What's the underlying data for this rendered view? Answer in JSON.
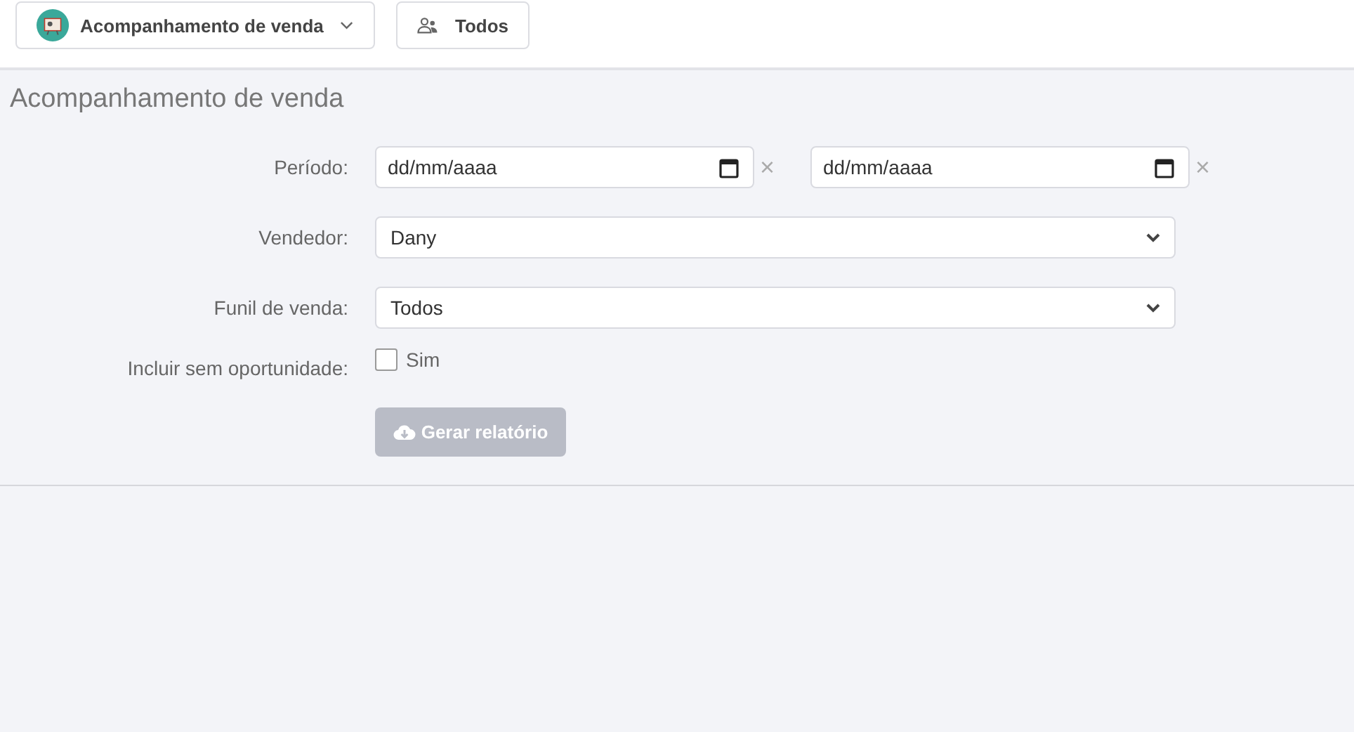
{
  "toolbar": {
    "report_menu": {
      "label": "Acompanhamento de venda"
    },
    "team_button": {
      "label": "Todos"
    }
  },
  "page_title": "Acompanhamento de venda",
  "form": {
    "period": {
      "label": "Período:",
      "fields": [
        {
          "placeholder": "dd/mm/aaaa",
          "clear": "×"
        },
        {
          "placeholder": "dd/mm/aaaa",
          "clear": "×"
        }
      ]
    },
    "seller": {
      "label": "Vendedor:",
      "value": "Dany"
    },
    "funnel": {
      "label": "Funil de venda:",
      "value": "Todos"
    },
    "no_opportunity": {
      "label": "Incluir sem oportunidade:",
      "option": "Sim",
      "checked": false
    },
    "submit": {
      "label": "Gerar relatório",
      "disabled": true
    }
  }
}
